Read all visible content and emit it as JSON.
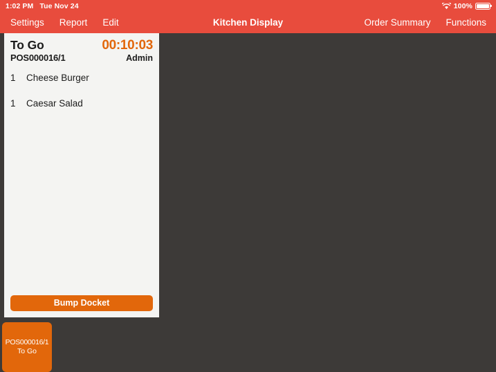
{
  "colors": {
    "nav_red": "#e84c3d",
    "background_dark": "#3d3a38",
    "accent_orange": "#e2670b",
    "card_background": "#f4f4f2",
    "text_dark": "#1b1b1b",
    "text_light": "#ffffff"
  },
  "status_bar": {
    "time": "1:02 PM",
    "date": "Tue Nov 24",
    "wifi_icon": "wifi-icon",
    "battery_percent": "100%",
    "battery_icon": "battery-icon"
  },
  "nav_bar": {
    "title": "Kitchen Display",
    "left_items": [
      {
        "label": "Settings",
        "name": "nav-item-settings"
      },
      {
        "label": "Report",
        "name": "nav-item-report"
      },
      {
        "label": "Edit",
        "name": "nav-item-edit"
      }
    ],
    "right_items": [
      {
        "label": "Order Summary",
        "name": "nav-item-order-summary"
      },
      {
        "label": "Functions",
        "name": "nav-item-functions"
      }
    ]
  },
  "docket": {
    "order_type": "To Go",
    "reference": "POS000016/1",
    "timer": "00:10:03",
    "user": "Admin",
    "items": [
      {
        "qty": "1",
        "name": "Cheese Burger"
      },
      {
        "qty": "1",
        "name": "Caesar Salad"
      }
    ],
    "bump_label": "Bump Docket"
  },
  "tiles": [
    {
      "reference": "POS000016/1",
      "order_type": "To Go"
    }
  ]
}
